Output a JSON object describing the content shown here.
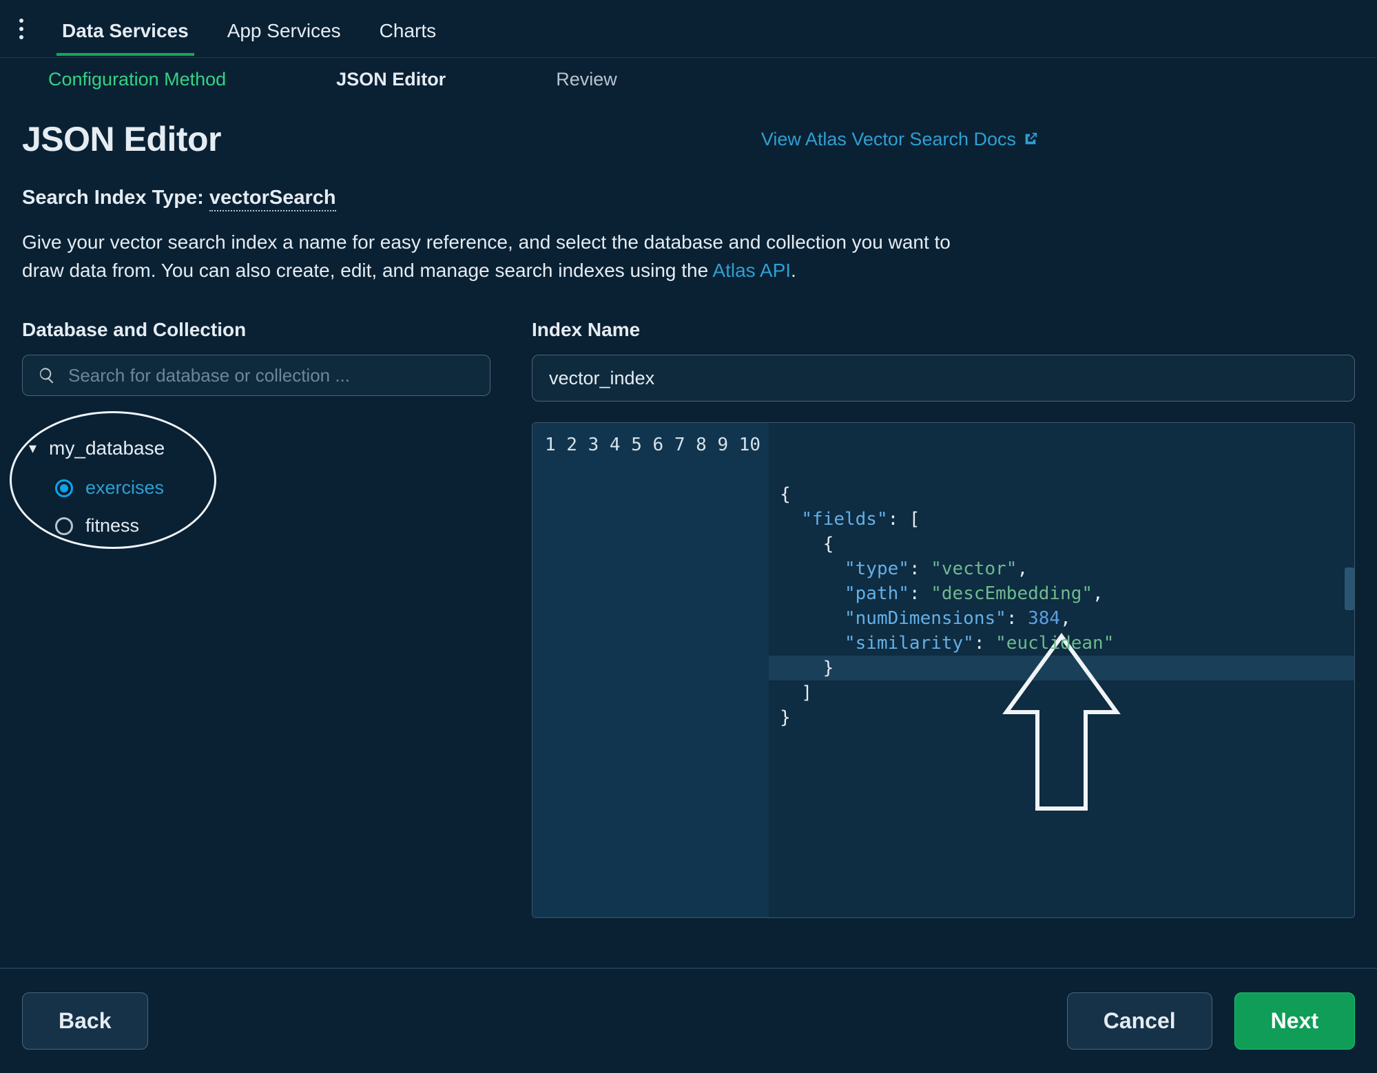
{
  "topnav": {
    "tabs": [
      "Data Services",
      "App Services",
      "Charts"
    ],
    "active_index": 0
  },
  "steps": [
    {
      "label": "Configuration Method",
      "state": "completed"
    },
    {
      "label": "JSON Editor",
      "state": "current"
    },
    {
      "label": "Review",
      "state": "upcoming"
    }
  ],
  "page_title": "JSON Editor",
  "docs_link_label": "View Atlas Vector Search Docs",
  "index_type": {
    "label": "Search Index Type:",
    "value": "vectorSearch"
  },
  "description": {
    "text_a": "Give your vector search index a name for easy reference, and select the database and collection you want to draw data from. You can also create, edit, and manage search indexes using the ",
    "link": "Atlas API",
    "text_b": "."
  },
  "left": {
    "section_label": "Database and Collection",
    "search_placeholder": "Search for database or collection ...",
    "database": {
      "name": "my_database",
      "expanded": true,
      "collections": [
        {
          "name": "exercises",
          "selected": true
        },
        {
          "name": "fitness",
          "selected": false
        }
      ]
    }
  },
  "right": {
    "section_label": "Index Name",
    "index_name_value": "vector_index",
    "code_lines": [
      {
        "n": 1,
        "tokens": [
          [
            "p",
            "{"
          ]
        ]
      },
      {
        "n": 2,
        "tokens": [
          [
            "k",
            "  \"fields\""
          ],
          [
            "p",
            ": ["
          ]
        ]
      },
      {
        "n": 3,
        "tokens": [
          [
            "p",
            "    {"
          ]
        ]
      },
      {
        "n": 4,
        "tokens": [
          [
            "k",
            "      \"type\""
          ],
          [
            "p",
            ": "
          ],
          [
            "s",
            "\"vector\""
          ],
          [
            "p",
            ","
          ]
        ]
      },
      {
        "n": 5,
        "tokens": [
          [
            "k",
            "      \"path\""
          ],
          [
            "p",
            ": "
          ],
          [
            "s",
            "\"descEmbedding\""
          ],
          [
            "p",
            ","
          ]
        ]
      },
      {
        "n": 6,
        "tokens": [
          [
            "k",
            "      \"numDimensions\""
          ],
          [
            "p",
            ": "
          ],
          [
            "n",
            "384"
          ],
          [
            "p",
            ","
          ]
        ]
      },
      {
        "n": 7,
        "tokens": [
          [
            "k",
            "      \"similarity\""
          ],
          [
            "p",
            ": "
          ],
          [
            "s",
            "\"euclidean\""
          ]
        ]
      },
      {
        "n": 8,
        "tokens": [
          [
            "p",
            "    }"
          ]
        ]
      },
      {
        "n": 9,
        "tokens": [
          [
            "p",
            "  ]"
          ]
        ]
      },
      {
        "n": 10,
        "tokens": [
          [
            "p",
            "}"
          ]
        ],
        "highlighted": true
      }
    ]
  },
  "footer": {
    "back": "Back",
    "cancel": "Cancel",
    "next": "Next"
  }
}
